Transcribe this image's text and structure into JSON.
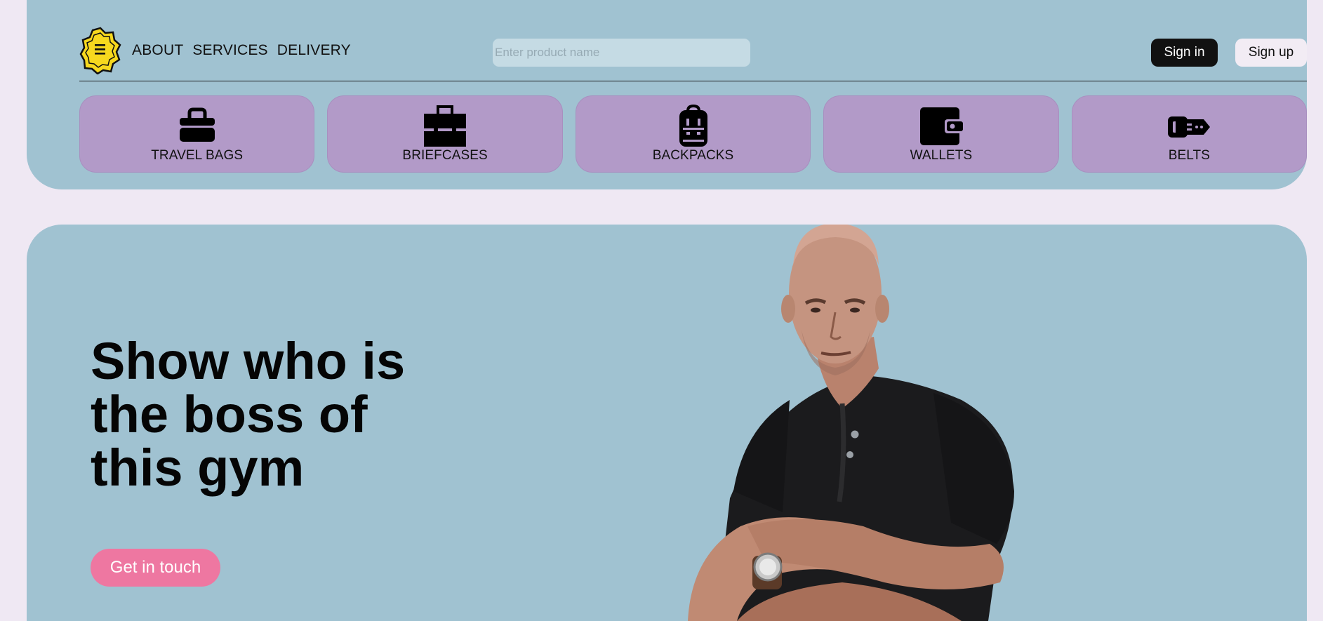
{
  "nav": {
    "links": [
      "ABOUT",
      "SERVICES",
      "DELIVERY"
    ]
  },
  "search": {
    "placeholder": "Enter product name",
    "value": ""
  },
  "auth": {
    "signin_label": "Sign in",
    "signup_label": "Sign up"
  },
  "categories": [
    {
      "label": "TRAVEL BAGS",
      "icon": "travel-bag-icon"
    },
    {
      "label": "BRIEFCASES",
      "icon": "briefcase-icon"
    },
    {
      "label": "BACKPACKS",
      "icon": "backpack-icon"
    },
    {
      "label": "WALLETS",
      "icon": "wallet-icon"
    },
    {
      "label": "BELTS",
      "icon": "belt-icon"
    }
  ],
  "hero": {
    "title_lines": [
      "Show who is",
      "the boss of",
      "this gym"
    ],
    "cta_label": "Get in touch",
    "photo": "man-with-crossed-arms-photo"
  },
  "colors": {
    "page_bg": "#efe8f3",
    "panel_bg": "#a0c2d1",
    "category_bg": "#b29ac8",
    "cta_bg": "#ee77a1",
    "logo_yellow": "#f7d81e",
    "signin_bg": "#111111"
  }
}
